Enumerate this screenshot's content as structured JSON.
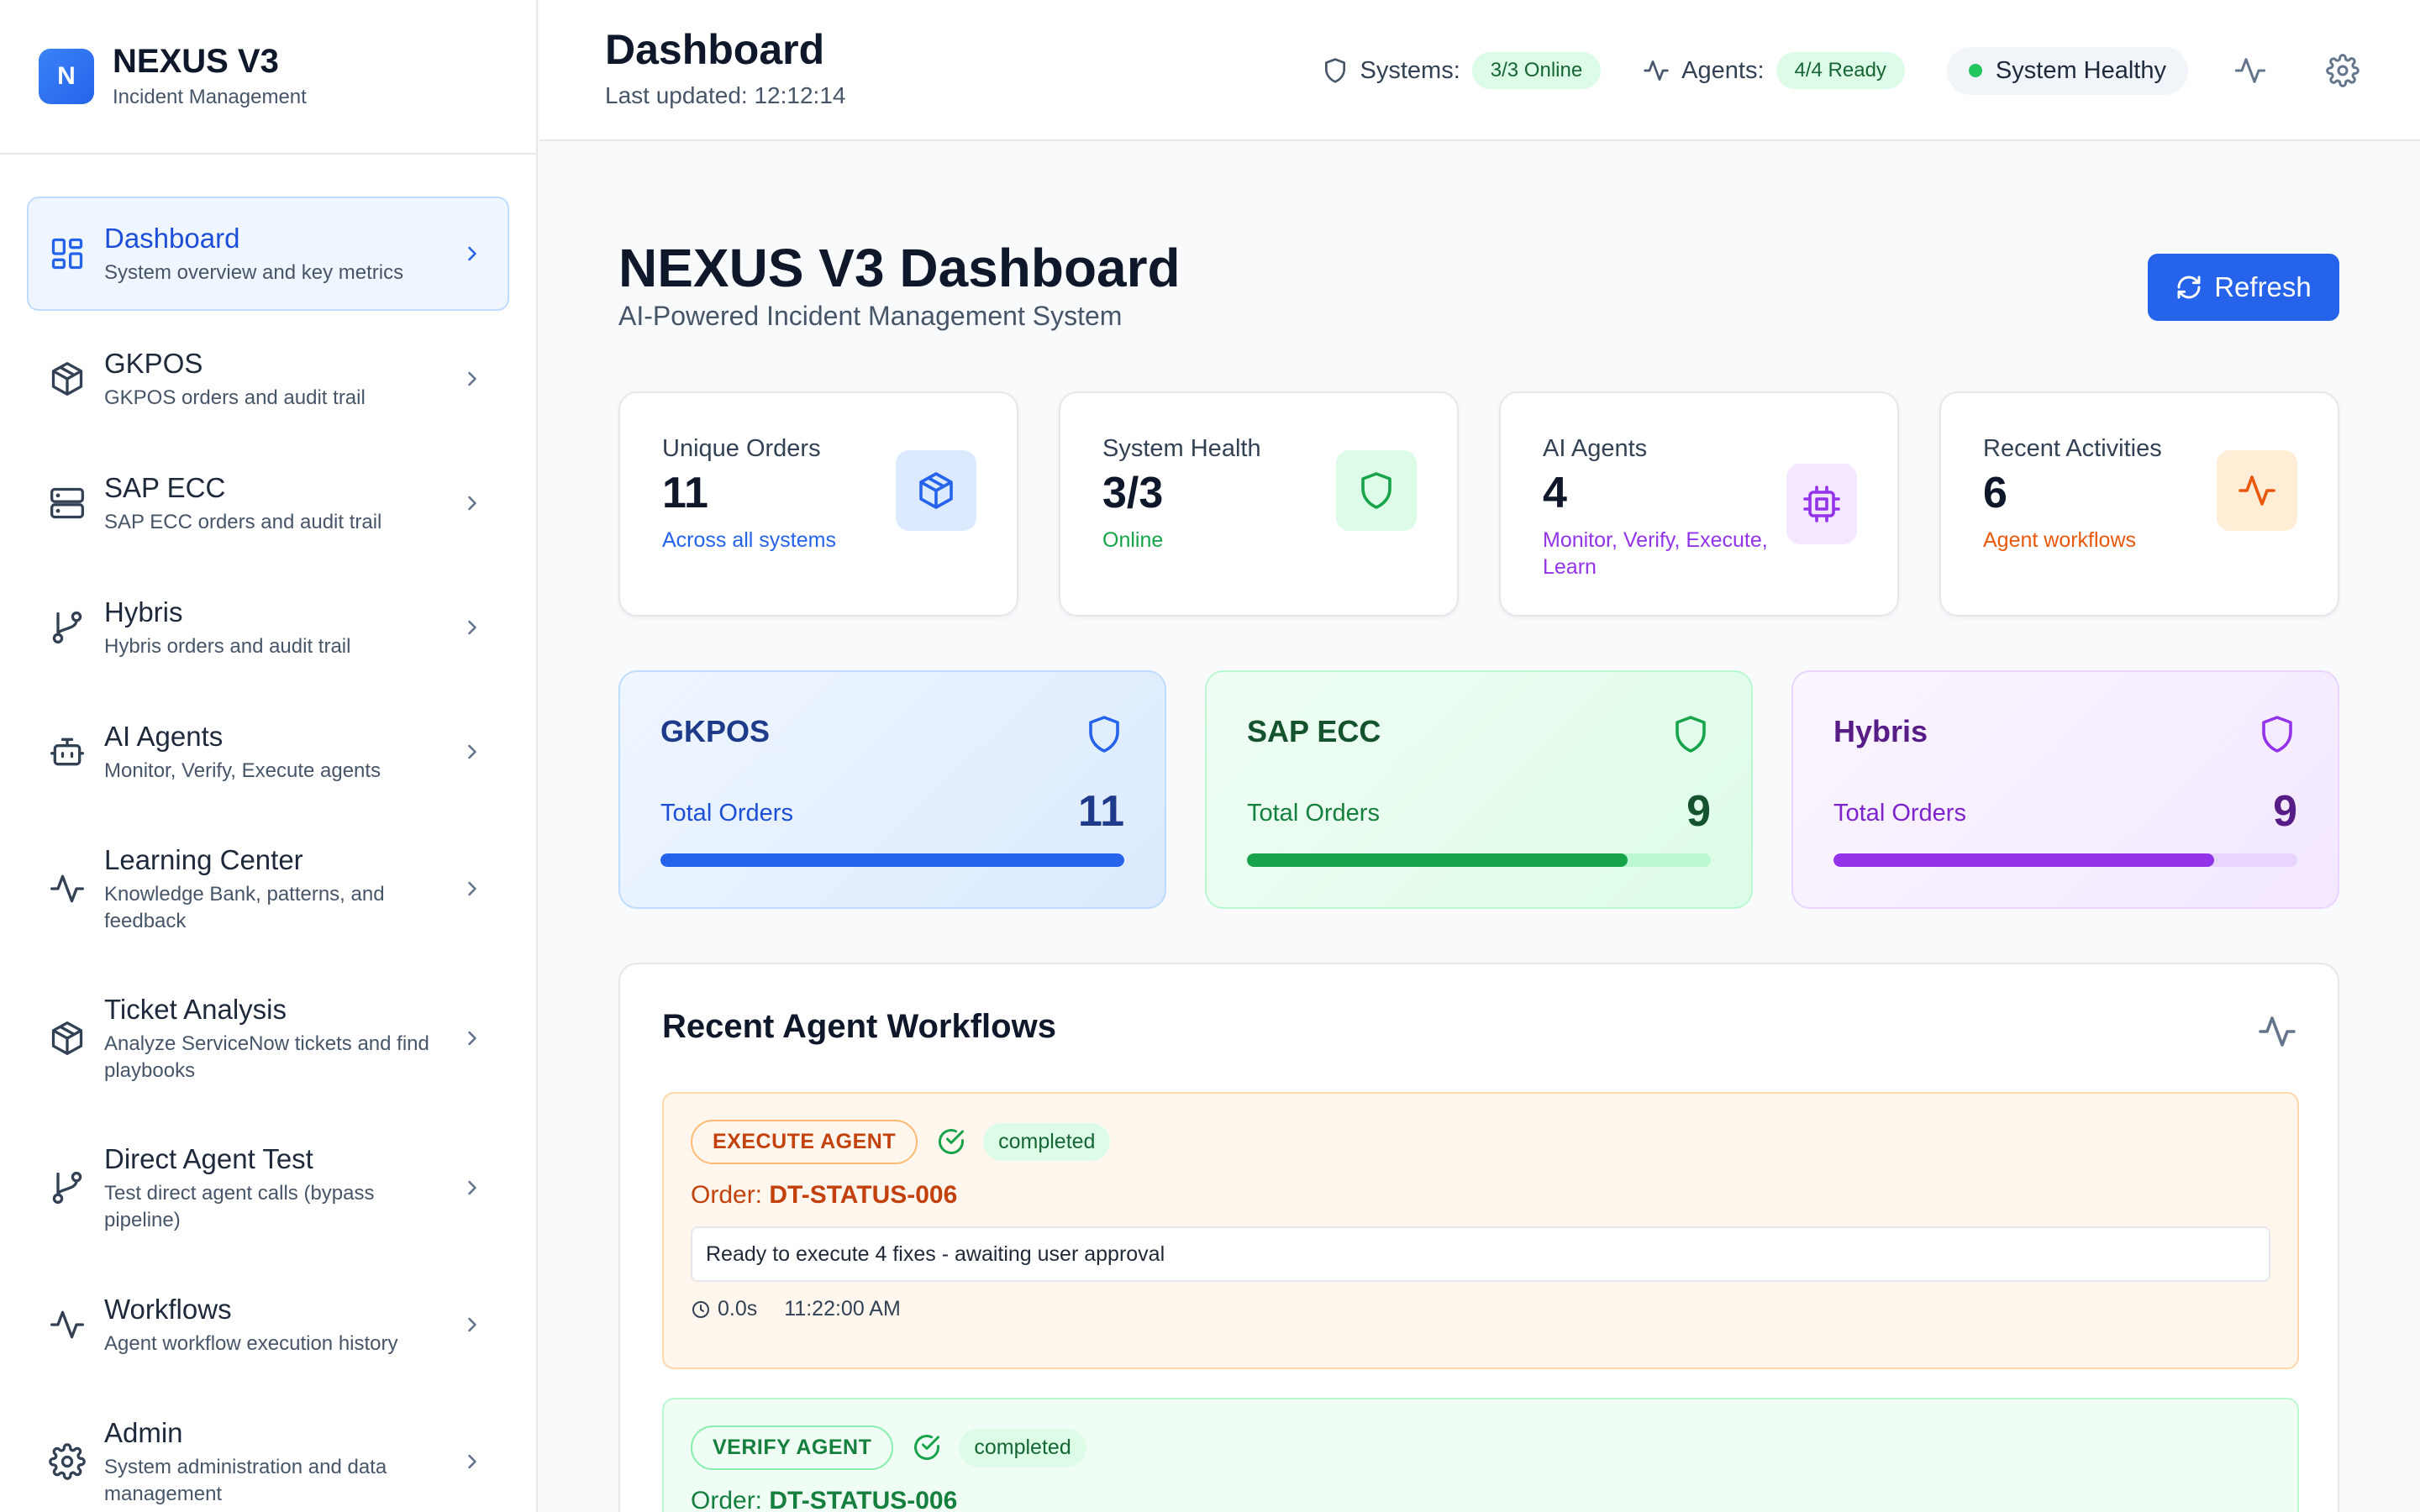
{
  "brand": {
    "logo_letter": "N",
    "title": "NEXUS V3",
    "subtitle": "Incident Management"
  },
  "sidebar": {
    "items": [
      {
        "label": "Dashboard",
        "desc": "System overview and key metrics",
        "icon": "grid-icon",
        "active": true
      },
      {
        "label": "GKPOS",
        "desc": "GKPOS orders and audit trail",
        "icon": "box-icon"
      },
      {
        "label": "SAP ECC",
        "desc": "SAP ECC orders and audit trail",
        "icon": "server-icon"
      },
      {
        "label": "Hybris",
        "desc": "Hybris orders and audit trail",
        "icon": "git-branch-icon"
      },
      {
        "label": "AI Agents",
        "desc": "Monitor, Verify, Execute agents",
        "icon": "bot-icon"
      },
      {
        "label": "Learning Center",
        "desc": "Knowledge Bank, patterns, and feedback",
        "icon": "activity-icon"
      },
      {
        "label": "Ticket Analysis",
        "desc": "Analyze ServiceNow tickets and find playbooks",
        "icon": "box-icon"
      },
      {
        "label": "Direct Agent Test",
        "desc": "Test direct agent calls (bypass pipeline)",
        "icon": "git-branch-icon"
      },
      {
        "label": "Workflows",
        "desc": "Agent workflow execution history",
        "icon": "activity-icon"
      },
      {
        "label": "Admin",
        "desc": "System administration and data management",
        "icon": "gear-icon"
      }
    ]
  },
  "header": {
    "title": "Dashboard",
    "last_updated": "Last updated: 12:12:14",
    "systems_label": "Systems:",
    "systems_value": "3/3 Online",
    "agents_label": "Agents:",
    "agents_value": "4/4 Ready",
    "health": "System Healthy"
  },
  "main": {
    "title": "NEXUS V3 Dashboard",
    "subtitle": "AI-Powered Incident Management System",
    "refresh_label": "Refresh",
    "kpis": [
      {
        "label": "Unique Orders",
        "value": "11",
        "note": "Across all systems",
        "icon": "box-icon",
        "accent": "#2563eb"
      },
      {
        "label": "System Health",
        "value": "3/3",
        "note": "Online",
        "icon": "shield-icon",
        "accent": "#16a34a"
      },
      {
        "label": "AI Agents",
        "value": "4",
        "note": "Monitor, Verify, Execute, Learn",
        "icon": "cpu-icon",
        "accent": "#9333ea"
      },
      {
        "label": "Recent Activities",
        "value": "6",
        "note": "Agent workflows",
        "icon": "activity-icon",
        "accent": "#ea580c"
      }
    ],
    "systems": [
      {
        "name": "GKPOS",
        "total_label": "Total Orders",
        "total": "11",
        "progress": 1.0,
        "color": "#2563eb"
      },
      {
        "name": "SAP ECC",
        "total_label": "Total Orders",
        "total": "9",
        "progress": 0.82,
        "color": "#16a34a"
      },
      {
        "name": "Hybris",
        "total_label": "Total Orders",
        "total": "9",
        "progress": 0.82,
        "color": "#9333ea"
      }
    ],
    "workflows": {
      "title": "Recent Agent Workflows",
      "items": [
        {
          "agent": "EXECUTE AGENT",
          "status": "completed",
          "order_label": "Order:",
          "order_id": "DT-STATUS-006",
          "message": "Ready to execute 4 fixes - awaiting user approval",
          "duration": "0.0s",
          "time": "11:22:00 AM"
        },
        {
          "agent": "VERIFY AGENT",
          "status": "completed",
          "order_label": "Order:",
          "order_id": "DT-STATUS-006"
        }
      ]
    }
  }
}
